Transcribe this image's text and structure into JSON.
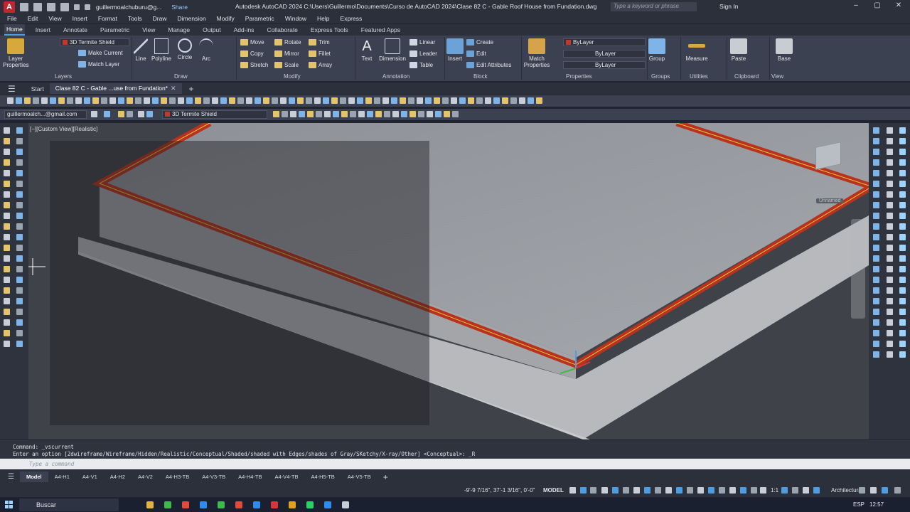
{
  "app": {
    "logo": "A",
    "title": "Autodesk AutoCAD 2024   C:\\Users\\Guillermo\\Documents\\Curso de AutoCAD 2024\\Clase 82 C - Gable Roof House from Fundation.dwg",
    "account": "guillermoalchuburu@g...",
    "share": "Share",
    "search_placeholder": "Type a keyword or phrase",
    "sign_in": "Sign In"
  },
  "menubar": [
    "File",
    "Edit",
    "View",
    "Insert",
    "Format",
    "Tools",
    "Draw",
    "Dimension",
    "Modify",
    "Parametric",
    "Window",
    "Help",
    "Express"
  ],
  "ribbon_tabs": [
    "Home",
    "Insert",
    "Annotate",
    "Parametric",
    "View",
    "Manage",
    "Output",
    "Add-ins",
    "Collaborate",
    "Express Tools",
    "Featured Apps"
  ],
  "ribbon": {
    "layer_properties": "Layer\nProperties",
    "layer_name": "3D Termite Shield",
    "make_current": "Make Current",
    "match_layer": "Match Layer",
    "line": "Line",
    "polyline": "Polyline",
    "circle": "Circle",
    "arc": "Arc",
    "move": "Move",
    "rotate": "Rotate",
    "trim": "Trim",
    "copy": "Copy",
    "mirror": "Mirror",
    "fillet": "Fillet",
    "stretch": "Stretch",
    "scale": "Scale",
    "array": "Array",
    "text": "Text",
    "dimension": "Dimension",
    "linear": "Linear",
    "leader": "Leader",
    "table": "Table",
    "insert": "Insert",
    "create": "Create",
    "edit": "Edit",
    "edit_attributes": "Edit Attributes",
    "match_properties": "Match\nProperties",
    "bylayer1": "ByLayer",
    "bylayer2": "ByLayer",
    "bylayer3": "ByLayer",
    "group": "Group",
    "measure": "Measure",
    "paste": "Paste",
    "base": "Base",
    "groups": {
      "layers": "Layers",
      "draw": "Draw",
      "modify": "Modify",
      "annotation": "Annotation",
      "block": "Block",
      "properties": "Properties",
      "groups": "Groups",
      "utilities": "Utilities",
      "clipboard": "Clipboard",
      "view": "View"
    }
  },
  "file_tabs": {
    "start": "Start",
    "active": "Clase 82 C - Gable ...use from Fundation*"
  },
  "toolbar": {
    "account_combo": "guillermoalch...@gmail.com",
    "layer_combo": "3D Termite Shield"
  },
  "viewport": {
    "label": "[−][Custom View][Realistic]",
    "unnamed": "Unnamed"
  },
  "command": {
    "line1": "Command: _vscurrent",
    "line2": "Enter an option [2dwireframe/Wireframe/Hidden/Realistic/Conceptual/Shaded/shaded with Edges/shades of Gray/SKetchy/X-ray/Other] <Conceptual>: _R",
    "placeholder": "Type a command"
  },
  "layout_tabs": [
    "Model",
    "A4-H1",
    "A4-V1",
    "A4-H2",
    "A4-V2",
    "A4-H3-TB",
    "A4-V3-TB",
    "A4-H4-TB",
    "A4-V4-TB",
    "A4-H5-TB",
    "A4-V5-TB"
  ],
  "status": {
    "coords": "-9'-9 7/16\", 37'-1 3/16\", 0'-0\"",
    "model": "MODEL",
    "scale": "1:1",
    "units": "Architectural"
  },
  "taskbar": {
    "search": "Buscar",
    "lang": "ESP",
    "time": "12:57"
  },
  "colors": {
    "shield_red": "#b8321e",
    "shield_line": "#e1c541",
    "accent_blue": "#4d9de0"
  }
}
